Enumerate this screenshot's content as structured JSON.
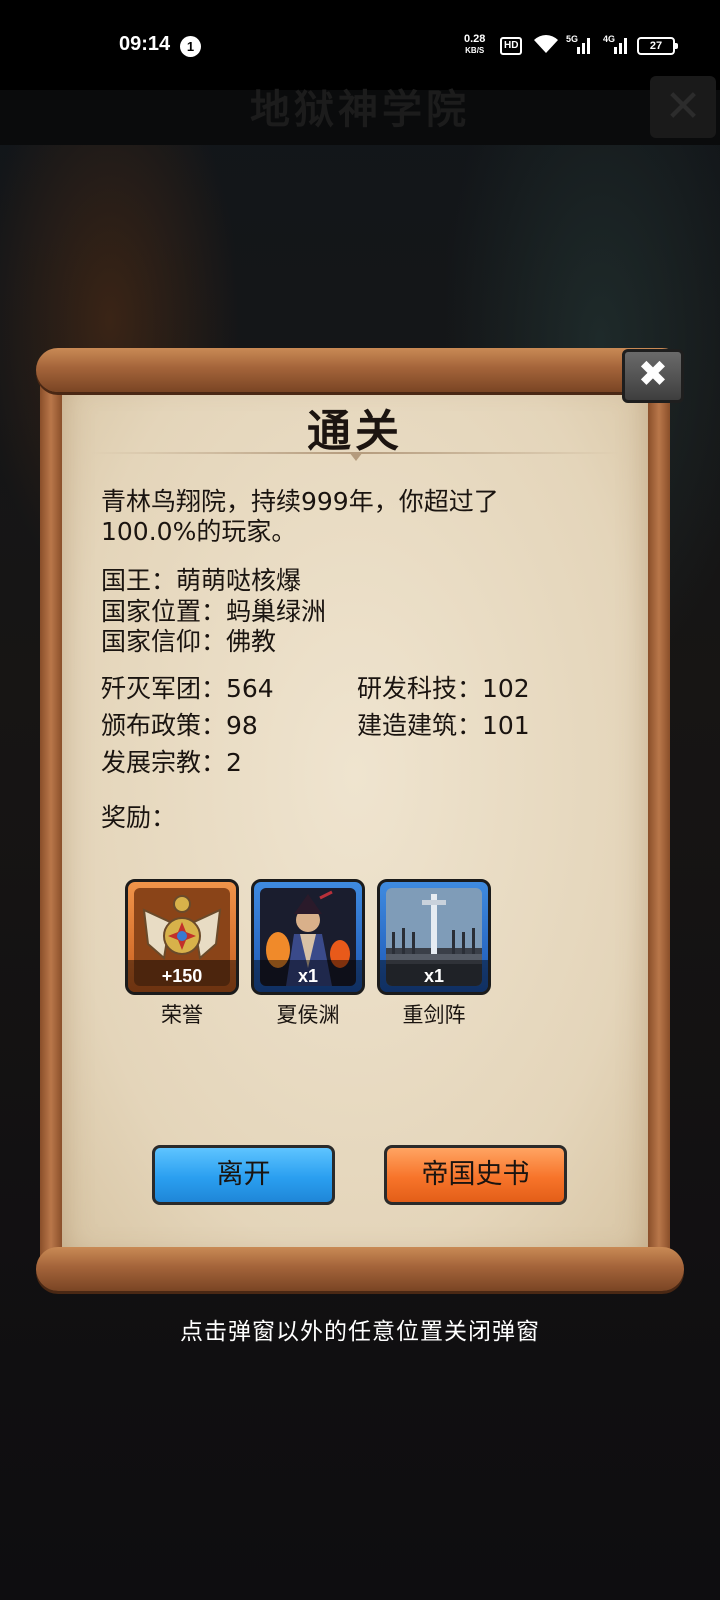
{
  "status_bar": {
    "time": "09:14",
    "notification_count": "1",
    "net_speed_value": "0.28",
    "net_speed_unit": "KB/S",
    "hd_badge": "HD",
    "battery": "27"
  },
  "background": {
    "title": "地狱神学院"
  },
  "dialog": {
    "title": "通关",
    "summary": "青林鸟翔院，持续999年，你超过了100.0%的玩家。",
    "king": "国王：萌萌哒核爆",
    "location": "国家位置：蚂巢绿洲",
    "faith": "国家信仰：佛教",
    "stats": {
      "armies_destroyed": "歼灭军团：564",
      "tech_researched": "研发科技：102",
      "policies_issued": "颁布政策：98",
      "buildings_built": "建造建筑：101",
      "religions_developed": "发展宗教：2"
    },
    "rewards_label": "奖励：",
    "rewards": [
      {
        "name": "荣誉",
        "qty": "+150",
        "icon": "honor-medal-icon",
        "frame": "orange"
      },
      {
        "name": "夏侯渊",
        "qty": "x1",
        "icon": "general-portrait-icon",
        "frame": "blue"
      },
      {
        "name": "重剑阵",
        "qty": "x1",
        "icon": "sword-formation-icon",
        "frame": "blue"
      }
    ],
    "leave_button": "离开",
    "history_button": "帝国史书"
  },
  "hint": "点击弹窗以外的任意位置关闭弹窗",
  "colors": {
    "accent_blue": "#2a9ff0",
    "accent_orange": "#f7742a",
    "paper": "#e4d5ba"
  }
}
